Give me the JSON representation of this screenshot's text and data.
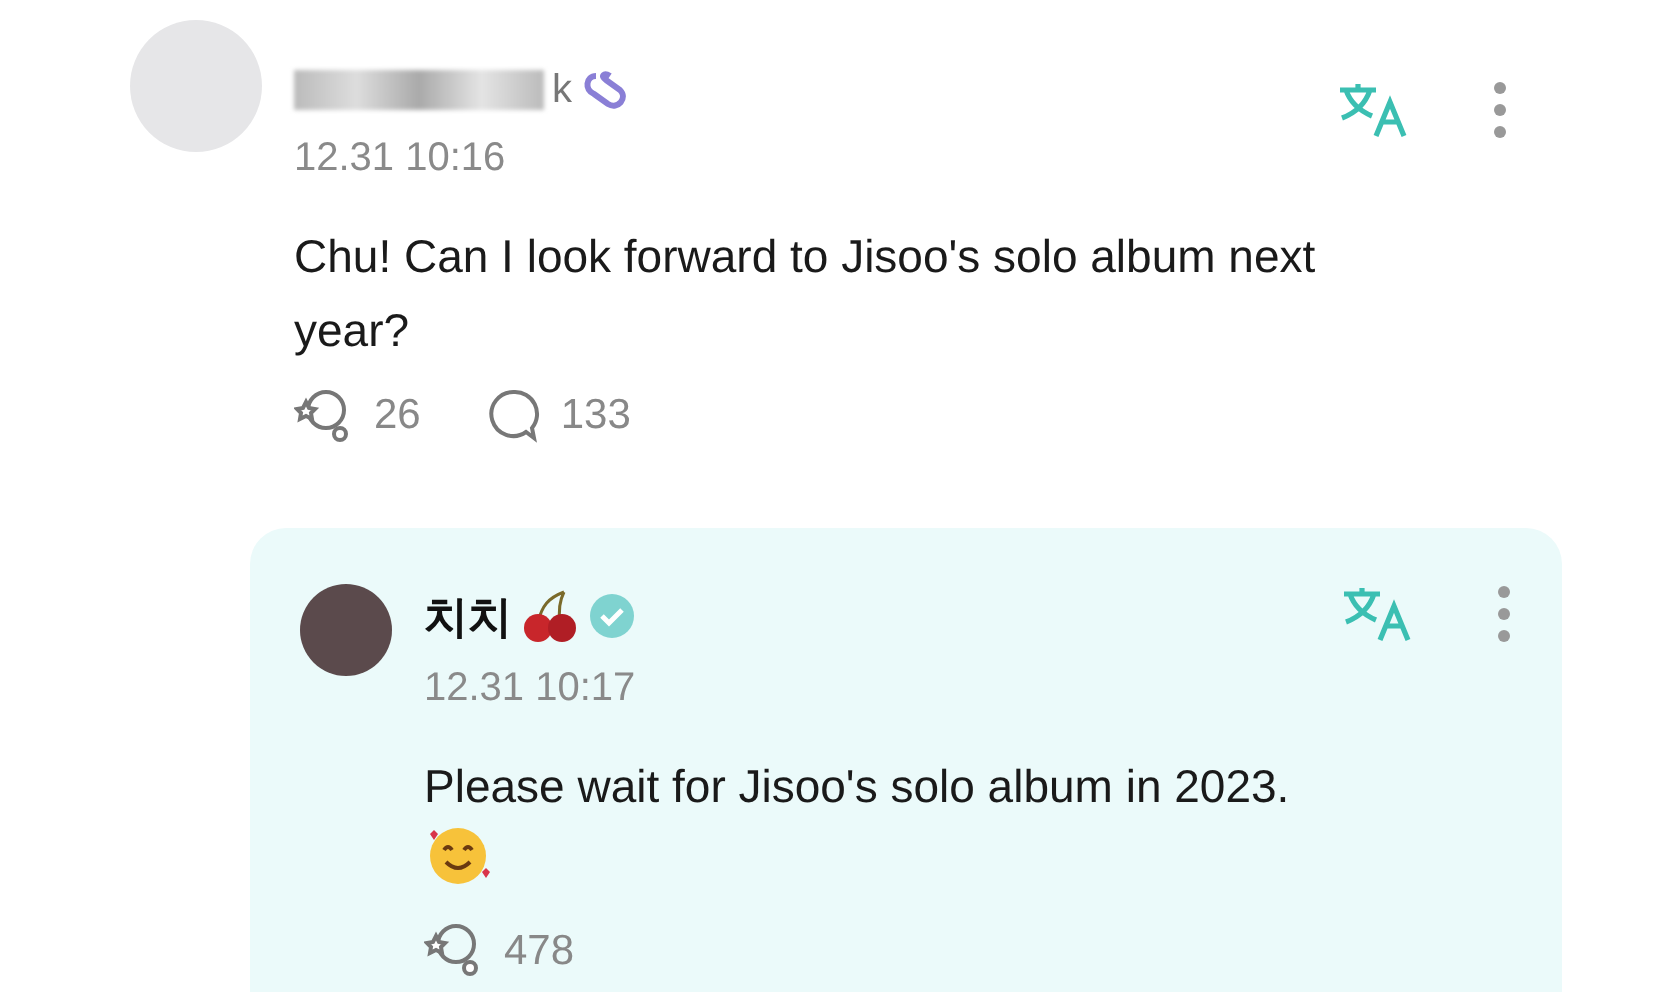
{
  "comment": {
    "author": "k",
    "time": "12.31 10:16",
    "text": "Chu! Can I look forward to Jisoo's solo album next year?",
    "likes": "26",
    "replies": "133"
  },
  "reply": {
    "author": "치치",
    "verified": true,
    "time": "12.31 10:17",
    "text": "Please wait for Jisoo's solo album in 2023.",
    "likes": "478"
  }
}
